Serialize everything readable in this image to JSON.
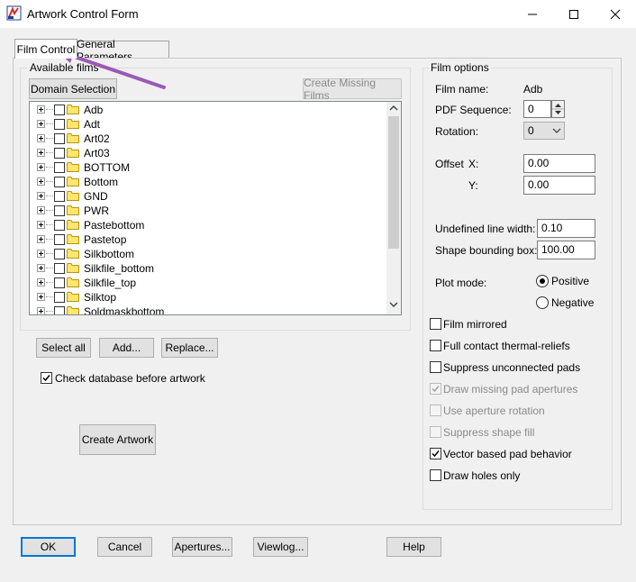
{
  "window": {
    "title": "Artwork Control Form"
  },
  "tabs": {
    "film_control": "Film Control",
    "general_parameters": "General Parameters"
  },
  "available_films": {
    "label": "Available films",
    "domain_selection": "Domain Selection",
    "create_missing_films": "Create Missing Films",
    "films": [
      "Adb",
      "Adt",
      "Art02",
      "Art03",
      "BOTTOM",
      "Bottom",
      "GND",
      "PWR",
      "Pastebottom",
      "Pastetop",
      "Silkbottom",
      "Silkfile_bottom",
      "Silkfile_top",
      "Silktop",
      "Soldmaskbottom"
    ],
    "select_all": "Select all",
    "add": "Add...",
    "replace": "Replace...",
    "check_database": "Check database before artwork",
    "create_artwork": "Create Artwork"
  },
  "film_options": {
    "label": "Film options",
    "film_name_label": "Film name:",
    "film_name_value": "Adb",
    "pdf_sequence_label": "PDF Sequence:",
    "pdf_sequence_value": "0",
    "rotation_label": "Rotation:",
    "rotation_value": "0",
    "offset_label": "Offset",
    "offset_x_label": "X:",
    "offset_x_value": "0.00",
    "offset_y_label": "Y:",
    "offset_y_value": "0.00",
    "undefined_line_width_label": "Undefined line width:",
    "undefined_line_width_value": "0.10",
    "shape_bounding_box_label": "Shape bounding box:",
    "shape_bounding_box_value": "100.00",
    "plot_mode_label": "Plot mode:",
    "positive": "Positive",
    "negative": "Negative",
    "film_mirrored": "Film mirrored",
    "full_contact": "Full contact thermal-reliefs",
    "suppress_unconnected": "Suppress unconnected pads",
    "draw_missing": "Draw missing pad apertures",
    "use_aperture_rotation": "Use aperture rotation",
    "suppress_shape_fill": "Suppress shape fill",
    "vector_based": "Vector based pad behavior",
    "draw_holes_only": "Draw holes only"
  },
  "footer": {
    "ok": "OK",
    "cancel": "Cancel",
    "apertures": "Apertures...",
    "viewlog": "Viewlog...",
    "help": "Help"
  },
  "colors": {
    "accent": "#0078d7",
    "arrow": "#9b59b6",
    "folder": "#ffe66d"
  }
}
